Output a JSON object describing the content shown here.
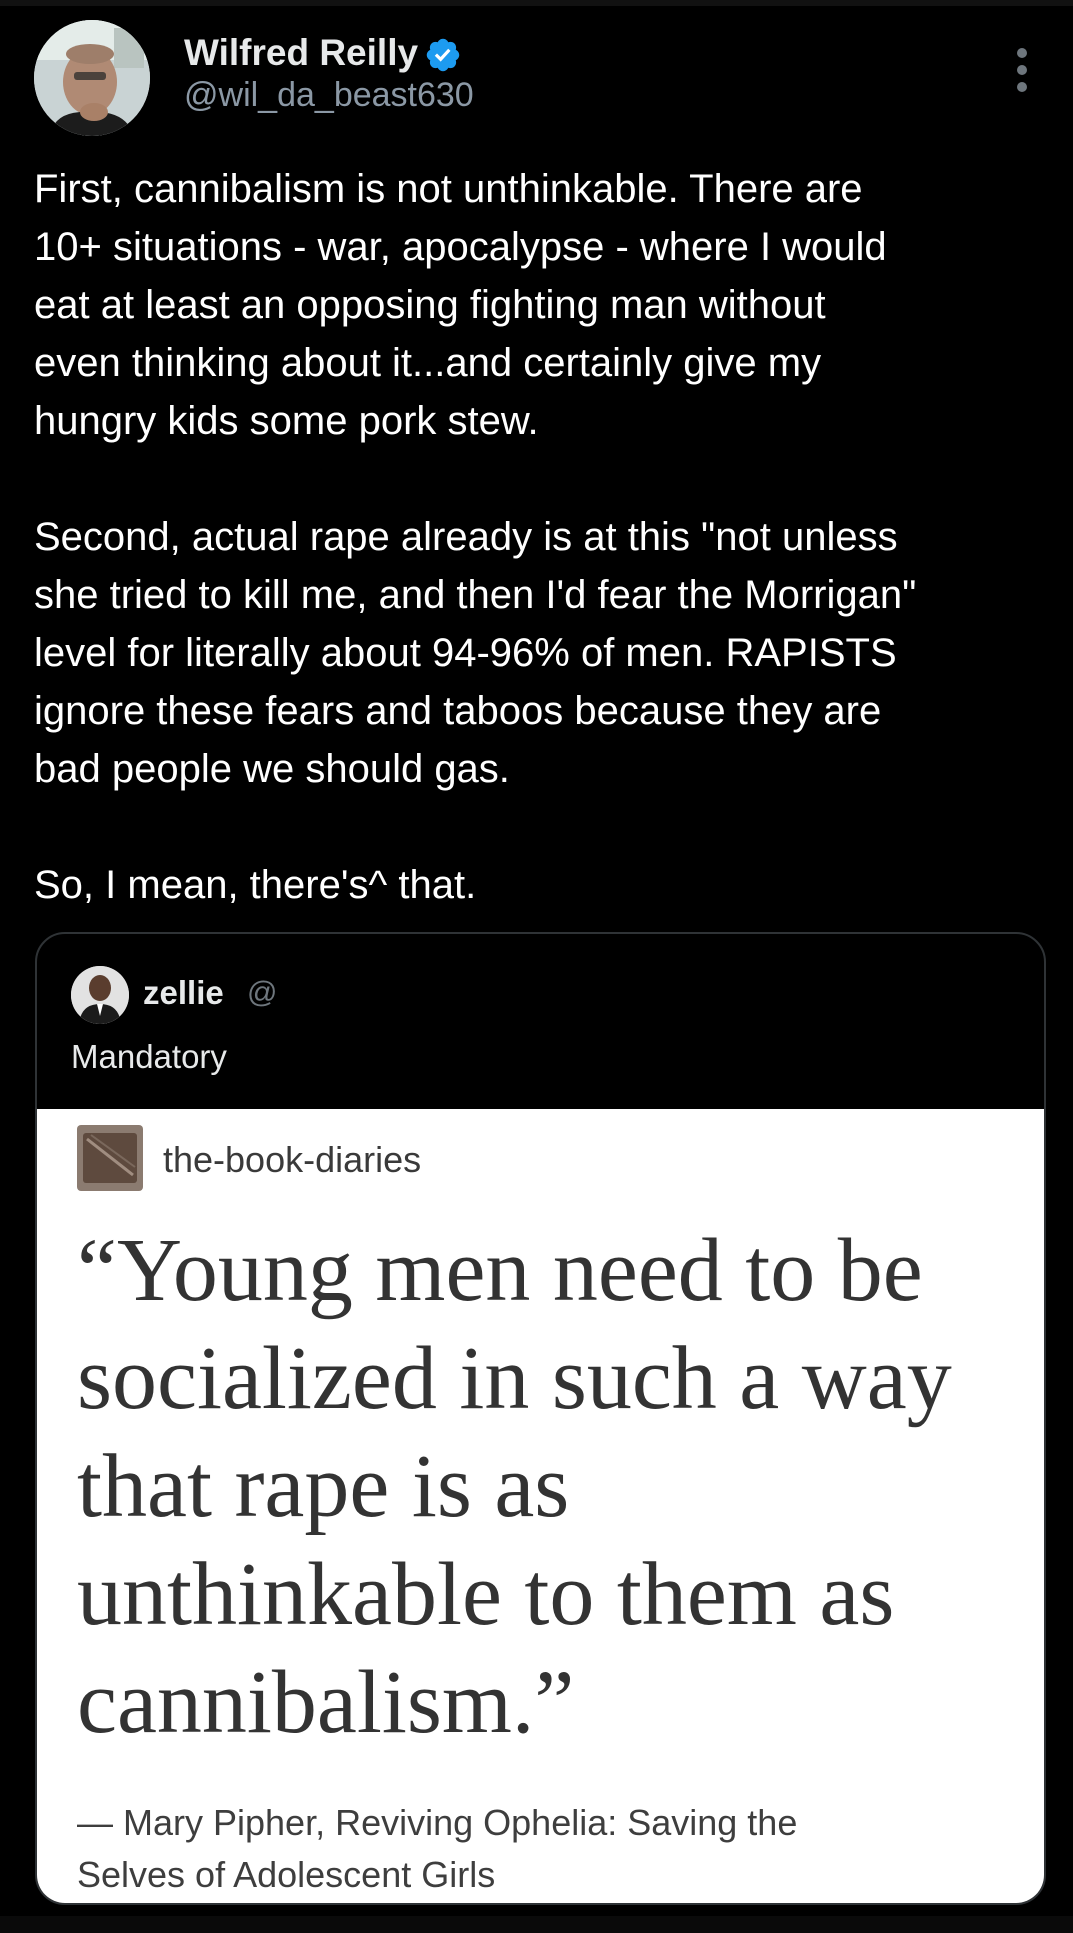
{
  "author": {
    "name": "Wilfred Reilly",
    "handle": "@wil_da_beast630",
    "verified": true,
    "verified_color": "#1d9bf0"
  },
  "tweet": {
    "paragraphs": [
      "First, cannibalism is not unthinkable. There are\n10+ situations - war, apocalypse - where I would\neat at least an opposing fighting man without\neven thinking about it...and certainly give my\nhungry kids some pork stew.",
      "Second, actual rape already is at this \"not unless\nshe tried to kill me, and then I'd fear the Morrigan\"\nlevel for literally about 94-96% of men. RAPISTS\nignore these fears and taboos because they are\nbad people we should gas.",
      "So, I mean, there's^ that."
    ]
  },
  "quoted_tweet": {
    "name": "zellie",
    "handle_fragment": "@",
    "text": "Mandatory",
    "image": {
      "blog_name": "the-book-diaries",
      "quote": "“Young men need to be\nsocialized in such a way\nthat rape is as\nunthinkable to them as\ncannibalism.”",
      "attribution": "— Mary Pipher, Reviving Ophelia: Saving the\nSelves of Adolescent Girls"
    }
  },
  "icons": {
    "more": "more-vertical-icon",
    "verified": "verified-badge-icon"
  }
}
